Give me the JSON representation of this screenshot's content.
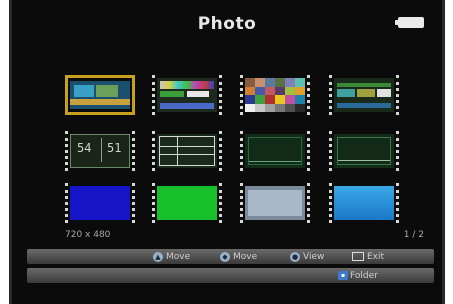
{
  "header": {
    "title": "Photo"
  },
  "status": {
    "resolution": "720 x 480",
    "page": "1 / 2"
  },
  "hints": {
    "move1": "Move",
    "move2": "Move",
    "view": "View",
    "exit": "Exit",
    "folder": "Folder"
  },
  "icons": {
    "battery": "battery-icon",
    "up-down": "up-down-icon",
    "left-right": "left-right-icon",
    "ok": "ok-icon",
    "exit": "exit-icon",
    "folder": "folder-icon"
  },
  "thumbnails": [
    {
      "name": "thumbnail-1",
      "type": "color-bars",
      "selected": true
    },
    {
      "name": "thumbnail-2",
      "type": "color-bars-2"
    },
    {
      "name": "thumbnail-3",
      "type": "color-checker"
    },
    {
      "name": "thumbnail-4",
      "type": "color-bars-3"
    },
    {
      "name": "thumbnail-5",
      "type": "number-test"
    },
    {
      "name": "thumbnail-6",
      "type": "grid-test"
    },
    {
      "name": "thumbnail-7",
      "type": "dark-green-test"
    },
    {
      "name": "thumbnail-8",
      "type": "dark-green-test-2"
    },
    {
      "name": "thumbnail-9",
      "type": "solid-blue"
    },
    {
      "name": "thumbnail-10",
      "type": "solid-green"
    },
    {
      "name": "thumbnail-11",
      "type": "gray-blue"
    },
    {
      "name": "thumbnail-12",
      "type": "light-blue"
    }
  ],
  "colors": {
    "selection": "#c8a020",
    "background": "#0b0b0b"
  }
}
